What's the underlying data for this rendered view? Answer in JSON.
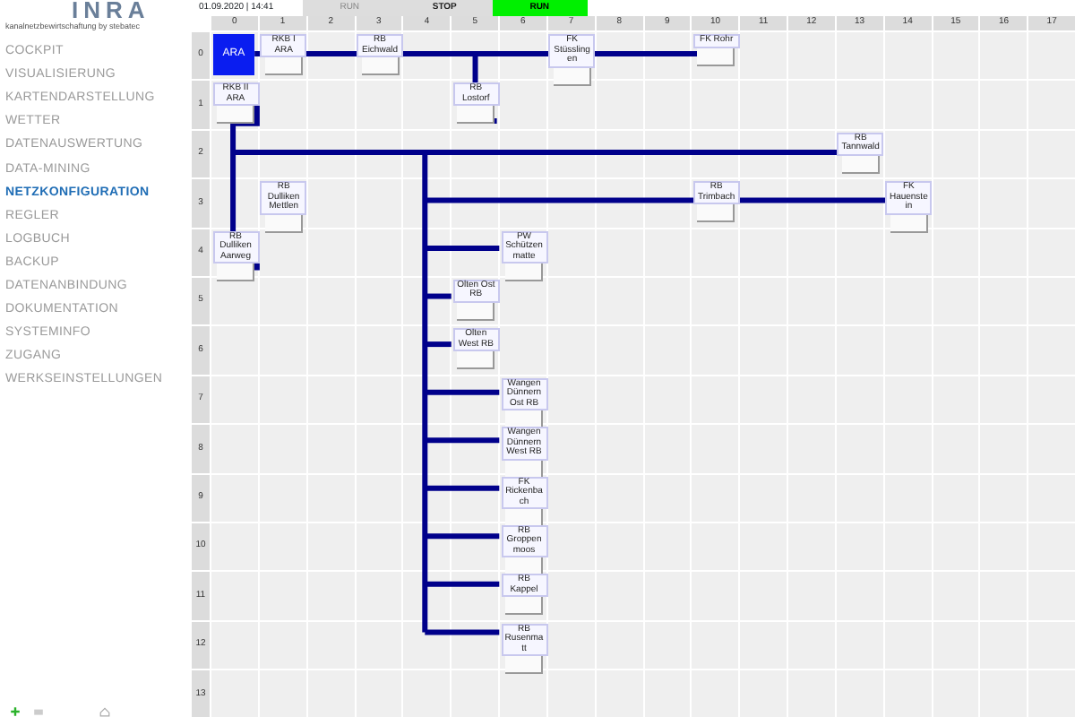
{
  "logo": {
    "name": "INRA",
    "tagline": "kanalnetzbewirtschaftung by stebatec"
  },
  "datetime": "01.09.2020 | 14:41",
  "mode_buttons": [
    {
      "label": "RUN",
      "selected": false
    },
    {
      "label": "STOP",
      "selected": false
    },
    {
      "label": "RUN",
      "selected": true
    }
  ],
  "menu": [
    {
      "label": "COCKPIT",
      "selected": false
    },
    {
      "label": "VISUALISIERUNG",
      "selected": false
    },
    {
      "label": "KARTENDARSTELLUNG",
      "selected": false
    },
    {
      "label": "WETTER",
      "selected": false
    },
    {
      "label": "DATENAUSWERTUNG",
      "selected": false
    },
    {
      "label": "DATA-MINING",
      "selected": false
    },
    {
      "label": "NETZKONFIGURATION",
      "selected": true
    },
    {
      "label": "REGLER",
      "selected": false
    },
    {
      "label": "LOGBUCH",
      "selected": false
    },
    {
      "label": "BACKUP",
      "selected": false
    },
    {
      "label": "DATENANBINDUNG",
      "selected": false
    },
    {
      "label": "DOKUMENTATION",
      "selected": false
    },
    {
      "label": "SYSTEMINFO",
      "selected": false
    },
    {
      "label": "ZUGANG",
      "selected": false
    },
    {
      "label": "WERKSEINSTELLUNGEN",
      "selected": false
    }
  ],
  "grid": {
    "columns": [
      "0",
      "1",
      "2",
      "3",
      "4",
      "5",
      "6",
      "7",
      "8",
      "9",
      "10",
      "11",
      "12",
      "13",
      "14",
      "15",
      "16",
      "17"
    ],
    "rows": [
      {
        "label": "0",
        "cells": [
          {
            "station": "ARA",
            "selected": true
          },
          {
            "station": "RKB I ARA",
            "selected": false
          },
          null,
          {
            "station": "RB Eichwald",
            "selected": false
          },
          null,
          null,
          null,
          {
            "station": "FK Stüsslingen",
            "selected": false
          },
          null,
          null,
          {
            "station": "FK Rohr",
            "selected": false
          }
        ]
      },
      {
        "label": "1",
        "cells": [
          {
            "station": "RKB II ARA",
            "selected": false
          },
          null,
          null,
          null,
          null,
          {
            "station": "RB Lostorf",
            "selected": false
          }
        ]
      },
      {
        "label": "2",
        "cells": [
          null,
          null,
          null,
          null,
          null,
          null,
          null,
          null,
          null,
          null,
          null,
          null,
          null,
          {
            "station": "RB Tannwald",
            "selected": false
          }
        ]
      },
      {
        "label": "3",
        "cells": [
          null,
          {
            "station": "RB Dulliken Mettlen",
            "selected": false
          },
          null,
          null,
          null,
          null,
          null,
          null,
          null,
          null,
          {
            "station": "RB Trimbach",
            "selected": false
          },
          null,
          null,
          null,
          {
            "station": "FK Hauenstein",
            "selected": false
          }
        ]
      },
      {
        "label": "4",
        "cells": [
          {
            "station": "RB Dulliken Aarweg",
            "selected": false
          },
          null,
          null,
          null,
          null,
          null,
          {
            "station": "PW Schützenmatte",
            "selected": false
          }
        ]
      },
      {
        "label": "5",
        "cells": [
          null,
          null,
          null,
          null,
          null,
          {
            "station": "Olten Ost RB",
            "selected": false
          }
        ]
      },
      {
        "label": "6",
        "cells": [
          null,
          null,
          null,
          null,
          null,
          {
            "station": "Olten West RB",
            "selected": false
          }
        ]
      },
      {
        "label": "7",
        "cells": [
          null,
          null,
          null,
          null,
          null,
          null,
          {
            "station": "Wangen Dünnern Ost RB",
            "selected": false
          }
        ]
      },
      {
        "label": "8",
        "cells": [
          null,
          null,
          null,
          null,
          null,
          null,
          {
            "station": "Wangen Dünnern West RB",
            "selected": false
          }
        ]
      },
      {
        "label": "9",
        "cells": [
          null,
          null,
          null,
          null,
          null,
          null,
          {
            "station": "FK Rickenbach",
            "selected": false
          }
        ]
      },
      {
        "label": "10",
        "cells": [
          null,
          null,
          null,
          null,
          null,
          null,
          {
            "station": "RB Groppenmoos",
            "selected": false
          }
        ]
      },
      {
        "label": "11",
        "cells": [
          null,
          null,
          null,
          null,
          null,
          null,
          {
            "station": "RB Kappel",
            "selected": false
          }
        ]
      },
      {
        "label": "12",
        "cells": [
          null,
          null,
          null,
          null,
          null,
          null,
          {
            "station": "RB Rusenmatt",
            "selected": false
          }
        ]
      },
      {
        "label": "13",
        "cells": []
      }
    ]
  }
}
